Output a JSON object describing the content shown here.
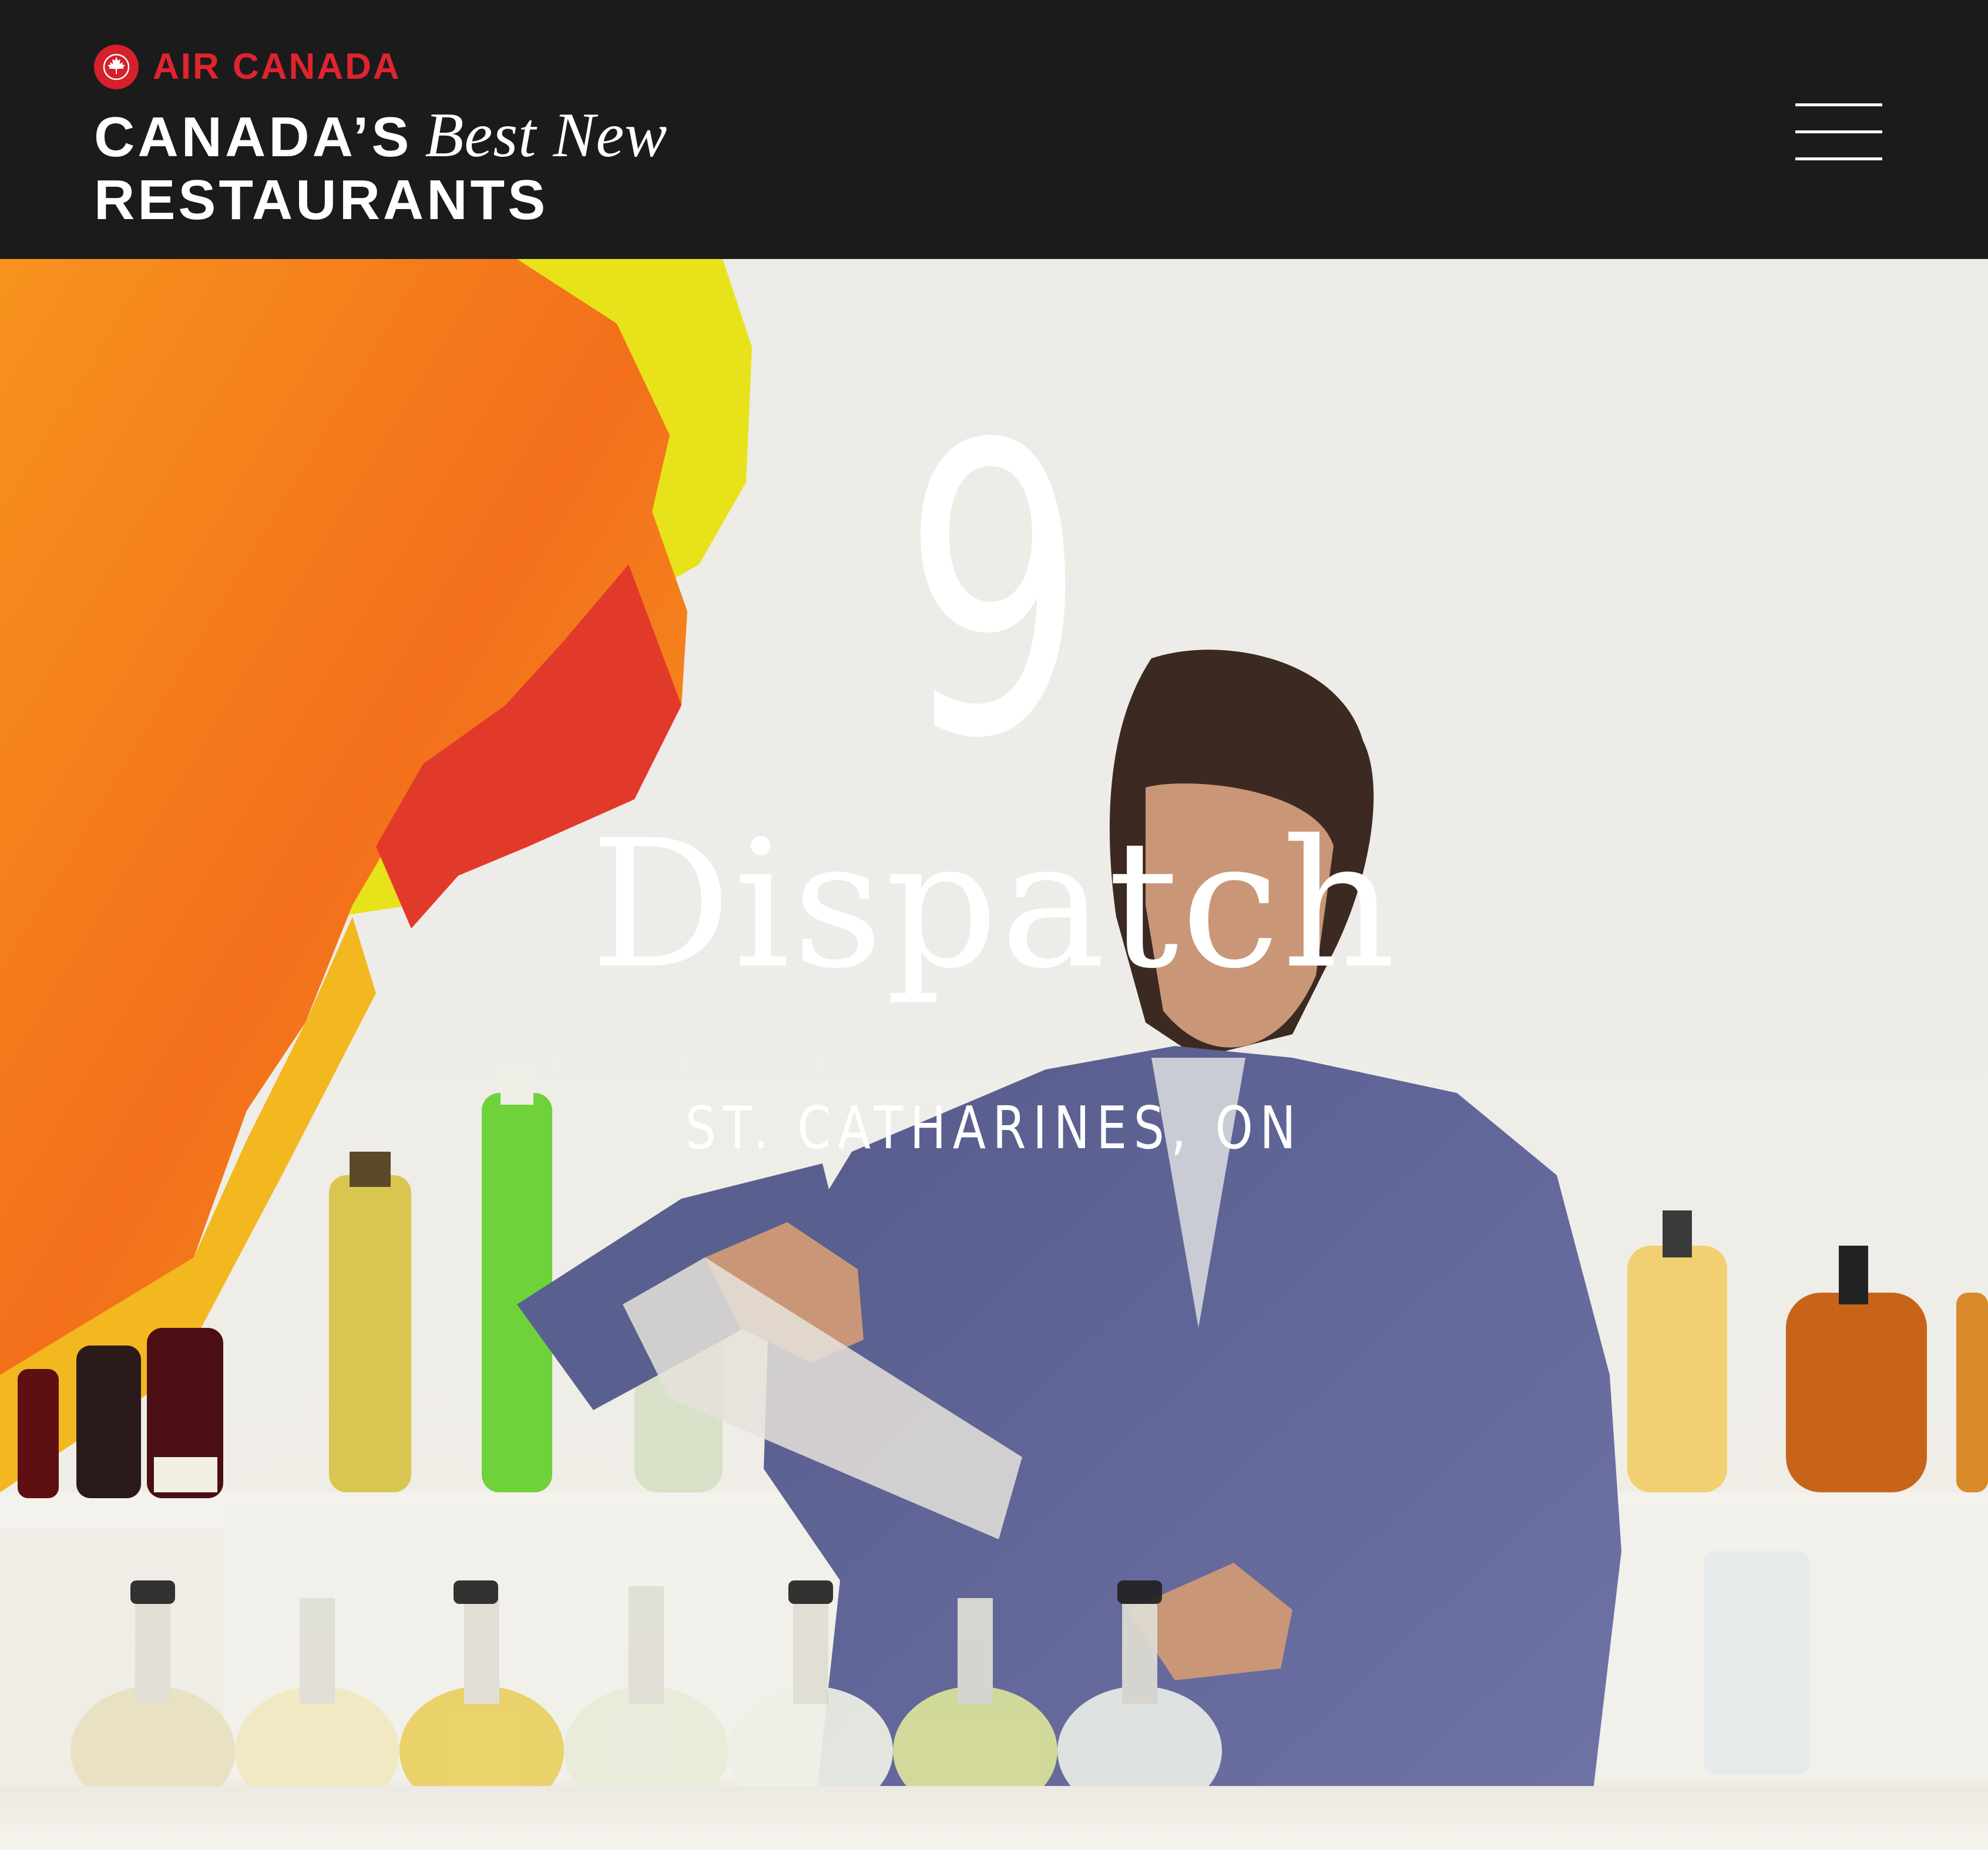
{
  "header": {
    "airline": "AIR CANADA",
    "title_bold_1": "CANADA’S",
    "title_script": "Best New",
    "title_bold_2": "RESTAURANTS",
    "menu_icon": "hamburger-menu-icon",
    "logo_icon": "maple-leaf-roundel-icon"
  },
  "hero": {
    "rank": "9",
    "restaurant_name": "Dispatch",
    "location": "ST. CATHARINES, ON",
    "photo_description_icon": "bartender-photo"
  },
  "colors": {
    "header_bg": "#1b1b1c",
    "brand_red": "#e0242f",
    "text_light": "#ffffff"
  }
}
